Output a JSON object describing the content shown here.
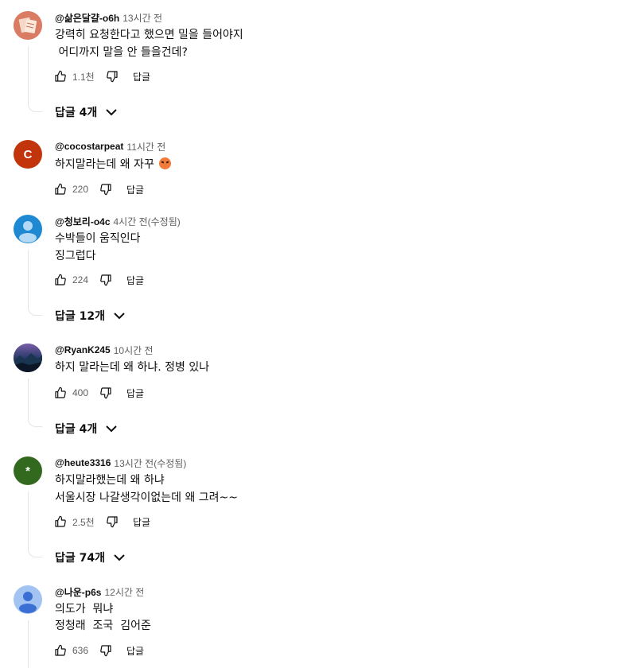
{
  "comments": [
    {
      "handle": "@삶은달걀-o6h",
      "time": "13시간 전",
      "lines": [
        "강력히 요청한다고 했으면 밀을 들어야지",
        " 어디까지 말을 안 들을건데?"
      ],
      "likes": "1.1천",
      "reply_label": "답글",
      "replies_label": "답글 4개",
      "avatar_color": "#e07a5f"
    },
    {
      "handle": "@cocostarpeat",
      "time": "11시간 전",
      "lines": [
        "하지말라는데 왜 자꾸"
      ],
      "likes": "220",
      "reply_label": "답글",
      "avatar_letter": "C",
      "avatar_color": "#c1340c",
      "emoji_icon": "angry-face-icon"
    },
    {
      "handle": "@청보리-o4c",
      "time": "4시간 전(수정됨)",
      "lines": [
        "수박들이 움직인다",
        "징그럽다"
      ],
      "likes": "224",
      "reply_label": "답글",
      "replies_label": "답글 12개",
      "avatar_color": "#1e88d2"
    },
    {
      "handle": "@RyanK245",
      "time": "10시간 전",
      "lines": [
        "하지 말라는데 왜 하냐. 정병 있나"
      ],
      "likes": "400",
      "reply_label": "답글",
      "replies_label": "답글 4개",
      "avatar_color": "#1d2a4a"
    },
    {
      "handle": "@heute3316",
      "time": "13시간 전(수정됨)",
      "lines": [
        "하지말라했는데 왜 하냐",
        "서울시장 나갈생각이없는데 왜 그려~~"
      ],
      "likes": "2.5천",
      "reply_label": "답글",
      "replies_label": "답글 74개",
      "avatar_letter": "*",
      "avatar_color": "#33691e"
    },
    {
      "handle": "@나운-p6s",
      "time": "12시간 전",
      "lines": [
        "의도가  뭐냐",
        "정청래  조국  김어준"
      ],
      "likes": "636",
      "reply_label": "답글",
      "avatar_color": "#a3c4f3"
    }
  ]
}
